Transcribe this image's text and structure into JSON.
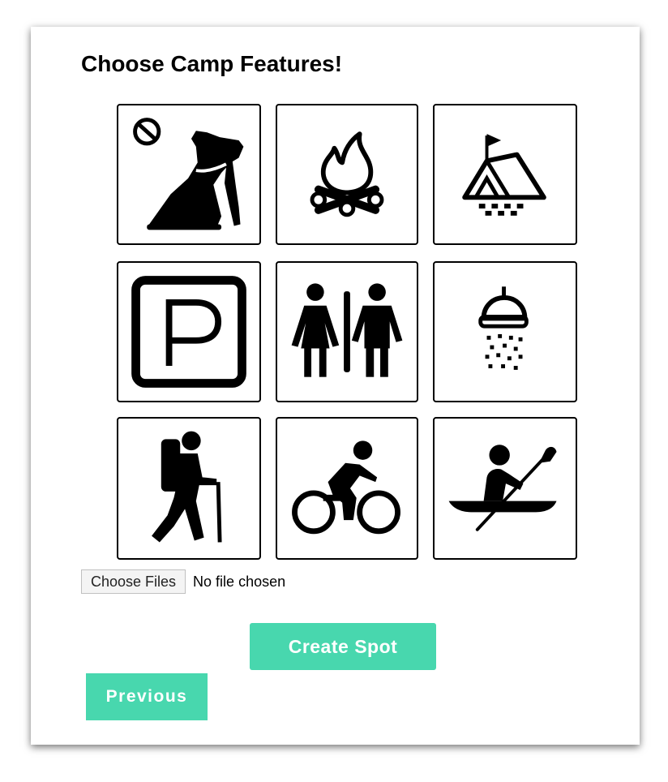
{
  "heading": "Choose Camp Features!",
  "features": [
    {
      "icon": "no-dogs-icon"
    },
    {
      "icon": "campfire-icon"
    },
    {
      "icon": "tent-icon"
    },
    {
      "icon": "parking-icon"
    },
    {
      "icon": "restroom-icon"
    },
    {
      "icon": "shower-icon"
    },
    {
      "icon": "hiking-icon"
    },
    {
      "icon": "biking-icon"
    },
    {
      "icon": "kayaking-icon"
    }
  ],
  "file_input": {
    "button_label": "Choose Files",
    "status": "No file chosen"
  },
  "buttons": {
    "create_spot": "Create Spot",
    "previous": "Previous"
  },
  "colors": {
    "accent": "#48d7ae"
  }
}
